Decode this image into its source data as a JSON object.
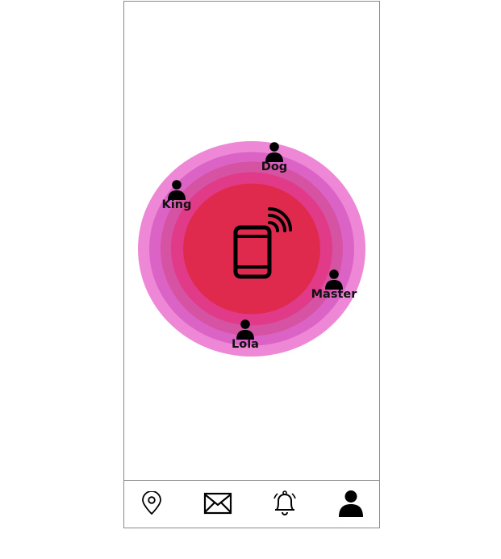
{
  "colors": {
    "ring_outer": "#ee88d6",
    "ring_2": "#dc63c6",
    "ring_3": "#d653a4",
    "ring_4": "#e03a88",
    "core": "#df2a4e",
    "icon": "#000000"
  },
  "center_device": {
    "icon": "smartphone-wireless-icon"
  },
  "contacts": [
    {
      "name": "Dog",
      "icon": "person-icon"
    },
    {
      "name": "King",
      "icon": "person-icon"
    },
    {
      "name": "Master",
      "icon": "person-icon"
    },
    {
      "name": "Lola",
      "icon": "person-icon"
    }
  ],
  "nav": [
    {
      "id": "location",
      "icon": "map-pin-icon"
    },
    {
      "id": "messages",
      "icon": "envelope-icon"
    },
    {
      "id": "notifications",
      "icon": "bell-icon"
    },
    {
      "id": "profile",
      "icon": "person-icon",
      "active": true
    }
  ]
}
